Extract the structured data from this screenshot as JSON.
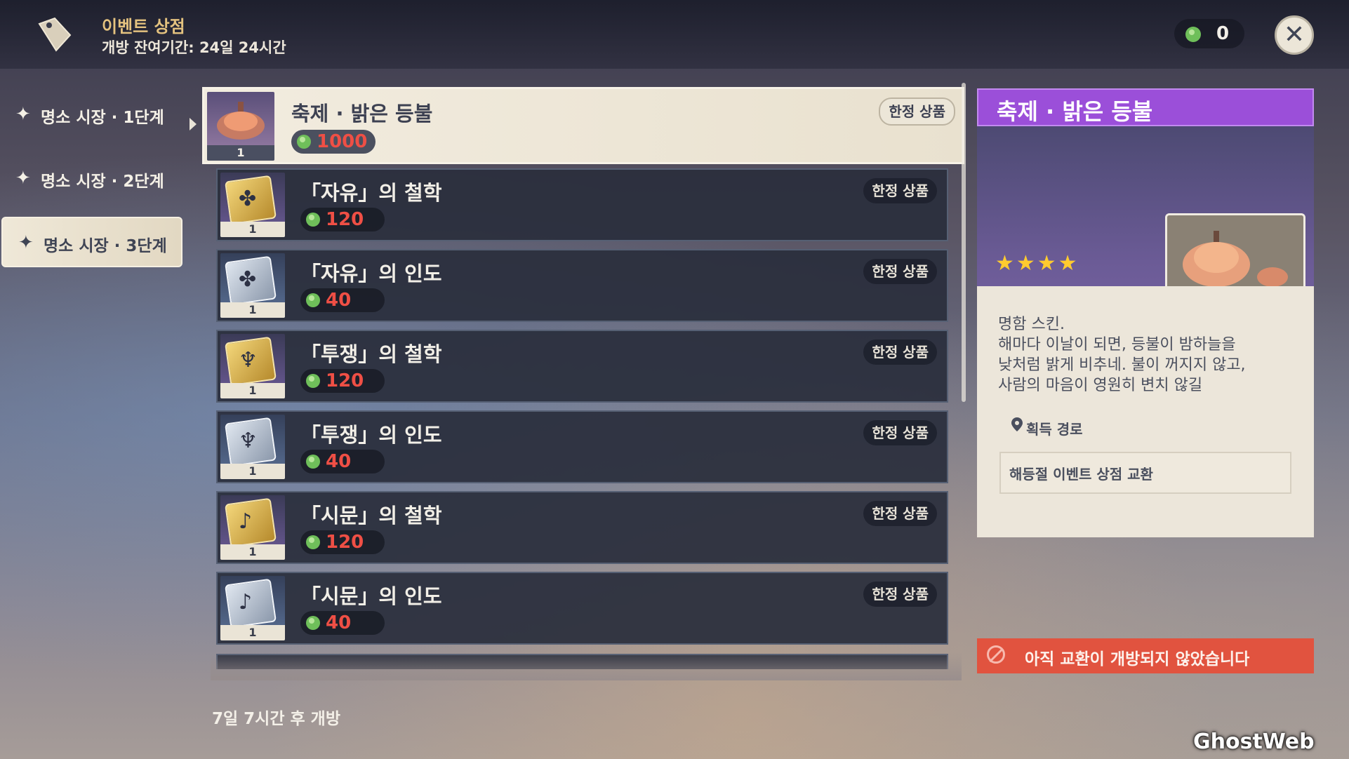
{
  "header": {
    "shop_title": "이벤트 상점",
    "remaining": "개방 잔여기간: 24일 24시간",
    "currency_value": "0",
    "currency_icon": "green-lantern-coin-icon",
    "close_icon": "close-icon"
  },
  "tabs": [
    {
      "label": "명소 시장 · 1단계",
      "active": false
    },
    {
      "label": "명소 시장 · 2단계",
      "active": false
    },
    {
      "label": "명소 시장 · 3단계",
      "active": true
    }
  ],
  "items": [
    {
      "name": "축제 · 밝은 등불",
      "price": "1000",
      "qty": "1",
      "badge": "한정 상품",
      "icon": "lantern-icon",
      "selected": true
    },
    {
      "name": "「자유」의 철학",
      "price": "120",
      "qty": "1",
      "badge": "한정 상품",
      "icon": "gold-book-icon"
    },
    {
      "name": "「자유」의 인도",
      "price": "40",
      "qty": "1",
      "badge": "한정 상품",
      "icon": "silver-book-icon"
    },
    {
      "name": "「투쟁」의 철학",
      "price": "120",
      "qty": "1",
      "badge": "한정 상품",
      "icon": "gold-book-icon"
    },
    {
      "name": "「투쟁」의 인도",
      "price": "40",
      "qty": "1",
      "badge": "한정 상품",
      "icon": "silver-book-icon"
    },
    {
      "name": "「시문」의 철학",
      "price": "120",
      "qty": "1",
      "badge": "한정 상품",
      "icon": "gold-book-icon"
    },
    {
      "name": "「시문」의 인도",
      "price": "40",
      "qty": "1",
      "badge": "한정 상품",
      "icon": "silver-book-icon"
    }
  ],
  "open_note": "7일 7시간 후 개방",
  "detail": {
    "title": "축제 · 밝은 등불",
    "rarity_stars": 4,
    "stars_text": "★★★★",
    "desc": [
      "명함 스킨.",
      "해마다 이날이 되면, 등불이 밤하늘을",
      "낮처럼 밝게 비추네. 불이 꺼지지 않고,",
      "사람의 마음이 영원히 변치 않길"
    ],
    "source_label": "획득 경로",
    "source_value": "해등절 이벤트 상점 교환",
    "header_color": "#9b4fd9"
  },
  "warning": "아직 교환이 개방되지 않았습니다",
  "watermark": "GhostWeb"
}
